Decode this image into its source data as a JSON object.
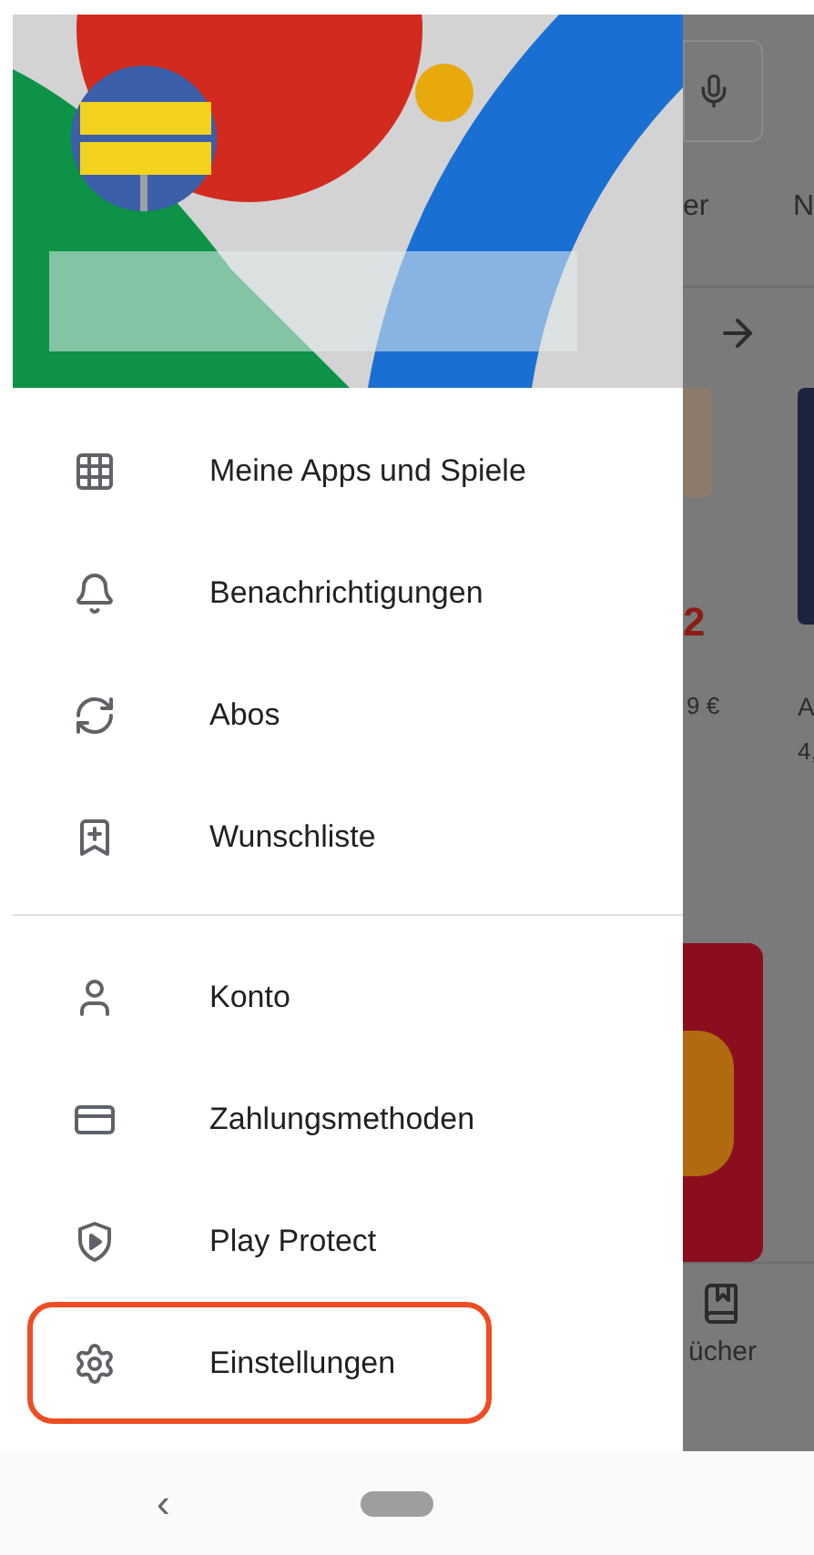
{
  "drawer": {
    "groups": [
      {
        "items": [
          {
            "label": "Meine Apps und Spiele",
            "highlighted": false
          },
          {
            "label": "Benachrichtigungen",
            "highlighted": false
          },
          {
            "label": "Abos",
            "highlighted": false
          },
          {
            "label": "Wunschliste",
            "highlighted": false
          }
        ]
      },
      {
        "items": [
          {
            "label": "Konto",
            "highlighted": false
          },
          {
            "label": "Zahlungsmethoden",
            "highlighted": false
          },
          {
            "label": "Play Protect",
            "highlighted": false
          },
          {
            "label": "Einstellungen",
            "highlighted": true
          }
        ]
      }
    ]
  },
  "background_page": {
    "tab_fragments": [
      "er",
      "N"
    ],
    "left_card": {
      "price_badge": "2",
      "price": "9 €"
    },
    "right_card": {
      "title": "A",
      "rating": "4,"
    },
    "bottom_tab": "ücher"
  },
  "nav_bar": {
    "back": "‹"
  }
}
